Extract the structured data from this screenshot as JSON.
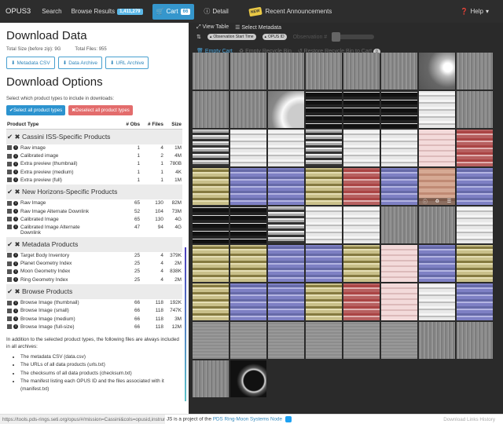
{
  "nav": {
    "brand": "OPUS3",
    "search": "Search",
    "browse": "Browse Results",
    "browse_count": "1,411,279",
    "cart": "Cart",
    "cart_count": "66",
    "detail": "Detail",
    "new_badge": "NEW",
    "announcements": "Recent Announcements",
    "help": "Help"
  },
  "download": {
    "title": "Download Data",
    "total_size": "Total Size (before zip): 9G",
    "total_files": "Total Files: 955",
    "buttons": [
      "Metadata CSV",
      "Data Archive",
      "URL Archive"
    ]
  },
  "options": {
    "title": "Download Options",
    "hint": "Select which product types to include in downloads:",
    "select_all": "Select all product types",
    "deselect_all": "Deselect all product types",
    "headers": [
      "Product Type",
      "# Obs",
      "# Files",
      "Size"
    ],
    "categories": [
      {
        "name": "Cassini ISS-Specific Products",
        "rows": [
          {
            "name": "Raw image",
            "obs": "1",
            "files": "4",
            "size": "1M"
          },
          {
            "name": "Calibrated image",
            "obs": "1",
            "files": "2",
            "size": "4M"
          },
          {
            "name": "Extra preview (thumbnail)",
            "obs": "1",
            "files": "1",
            "size": "780B"
          },
          {
            "name": "Extra preview (medium)",
            "obs": "1",
            "files": "1",
            "size": "4K"
          },
          {
            "name": "Extra preview (full)",
            "obs": "1",
            "files": "1",
            "size": "1M"
          }
        ]
      },
      {
        "name": "New Horizons-Specific Products",
        "rows": [
          {
            "name": "Raw Image",
            "obs": "65",
            "files": "130",
            "size": "82M"
          },
          {
            "name": "Raw Image Alternate Downlink",
            "obs": "52",
            "files": "104",
            "size": "73M"
          },
          {
            "name": "Calibrated Image",
            "obs": "65",
            "files": "130",
            "size": "4G"
          },
          {
            "name": "Calibrated Image Alternate",
            "name2": "Downlink",
            "obs": "47",
            "files": "94",
            "size": "4G"
          }
        ]
      },
      {
        "name": "Metadata Products",
        "rows": [
          {
            "name": "Target Body Inventory",
            "obs": "25",
            "files": "4",
            "size": "379K"
          },
          {
            "name": "Planet Geometry Index",
            "obs": "25",
            "files": "4",
            "size": "2M"
          },
          {
            "name": "Moon Geometry Index",
            "obs": "25",
            "files": "4",
            "size": "838K"
          },
          {
            "name": "Ring Geometry Index",
            "obs": "25",
            "files": "4",
            "size": "2M"
          }
        ]
      },
      {
        "name": "Browse Products",
        "rows": [
          {
            "name": "Browse Image (thumbnail)",
            "obs": "66",
            "files": "118",
            "size": "192K"
          },
          {
            "name": "Browse Image (small)",
            "obs": "66",
            "files": "118",
            "size": "747K"
          },
          {
            "name": "Browse Image (medium)",
            "obs": "66",
            "files": "118",
            "size": "3M"
          },
          {
            "name": "Browse Image (full-size)",
            "obs": "66",
            "files": "118",
            "size": "12M"
          }
        ]
      }
    ],
    "footnote": "In addition to the selected product types, the following files are always included in all archives:",
    "always": [
      "The metadata CSV (data.csv)",
      "The URLs of all data products (urls.txt)",
      "The checksums of all data products (checksum.txt)",
      "The manifest listing each OPUS ID and the files associated with it (manifest.txt)"
    ]
  },
  "gallery": {
    "view_table": "View Table",
    "select_metadata": "Select Metadata",
    "sort_tags": [
      "Observation Start Time",
      "OPUS ID"
    ],
    "observation_label": "Observation #",
    "empty_cart": "Empty Cart",
    "empty_recycle": "Empty Recycle Bin",
    "restore": "Restore Recycle Bin to Cart",
    "restore_count": "0",
    "tiles": [
      "g",
      "g",
      "g",
      "g",
      "g",
      "g",
      "moon",
      "g",
      "g",
      "g",
      "ring",
      "b",
      "b",
      "b",
      "w",
      "g",
      "gl",
      "w",
      "w",
      "gl",
      "w",
      "w",
      "p",
      "r",
      "y",
      "v",
      "v",
      "y",
      "r",
      "v",
      "t",
      "v",
      "b",
      "b",
      "gl",
      "w",
      "w",
      "g",
      "g",
      "w",
      "y",
      "y",
      "v",
      "v",
      "y",
      "p",
      "v",
      "y",
      "y",
      "v",
      "v",
      "y",
      "r",
      "p",
      "w",
      "v",
      "gs",
      "gs",
      "gs",
      "gs",
      "gs",
      "gs",
      "g",
      "g",
      "g",
      "sat"
    ]
  },
  "status": {
    "url": "https://tools.pds-rings.seti.org/opus/#/mission=Cassini&cols=opusid,instrum...",
    "project": "JS is a project of the",
    "node": "PDS Ring-Moon Systems Node",
    "history": "Download Links History"
  }
}
